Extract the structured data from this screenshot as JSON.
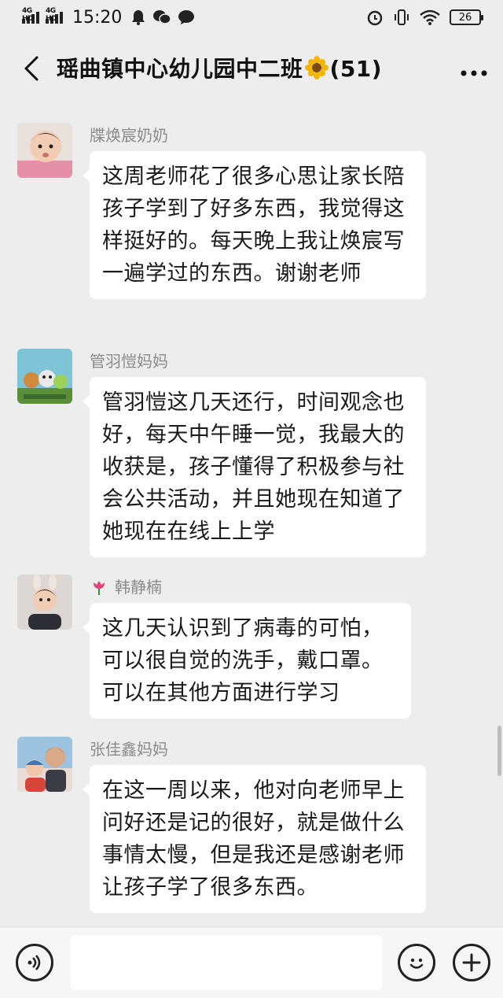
{
  "status": {
    "sig1": "4G HD",
    "sig2": "4G HD",
    "time": "15:20",
    "battery": "26"
  },
  "header": {
    "title": "瑶曲镇中心幼儿园中二班",
    "count": "(51)"
  },
  "messages": [
    {
      "sender": "牒焕宸奶奶",
      "text": "这周老师花了很多心思让家长陪孩子学到了好多东西，我觉得这样挺好的。每天晚上我让焕宸写一遍学过的东西。谢谢老师"
    },
    {
      "sender": "管羽愷妈妈",
      "text": "管羽愷这几天还行，时间观念也好，每天中午睡一觉，我最大的收获是，孩子懂得了积极参与社会公共活动，并且她现在知道了她现在在线上上学"
    },
    {
      "sender": "韩静楠",
      "text": "这几天认识到了病毒的可怕，可以很自觉的洗手，戴口罩。可以在其他方面进行学习"
    },
    {
      "sender": "张佳鑫妈妈",
      "text": "在这一周以来，他对向老师早上问好还是记的很好，就是做什么事情太慢，但是我还是感谢老师让孩子学了很多东西。"
    }
  ],
  "colors": {
    "background": "#ededed",
    "bubble": "#ffffff",
    "sender_name": "#8a8a8a"
  }
}
